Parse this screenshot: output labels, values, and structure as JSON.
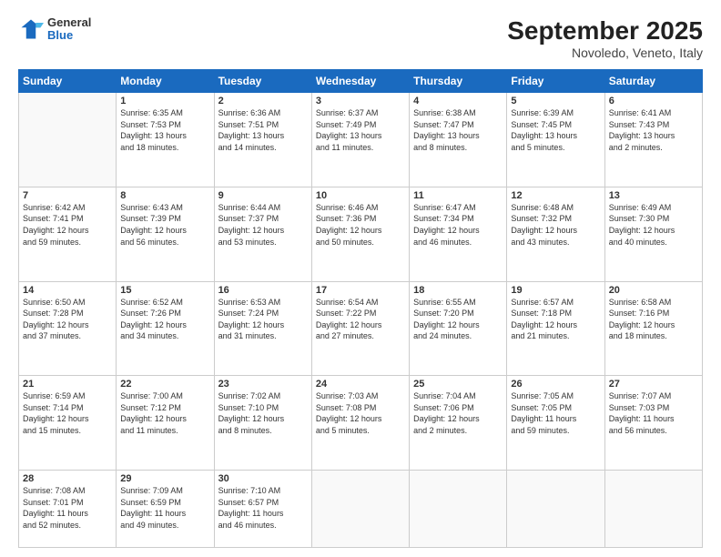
{
  "header": {
    "logo": {
      "general": "General",
      "blue": "Blue"
    },
    "title": "September 2025",
    "location": "Novoledo, Veneto, Italy"
  },
  "calendar": {
    "days_of_week": [
      "Sunday",
      "Monday",
      "Tuesday",
      "Wednesday",
      "Thursday",
      "Friday",
      "Saturday"
    ],
    "weeks": [
      [
        {
          "day": "",
          "details": ""
        },
        {
          "day": "1",
          "details": "Sunrise: 6:35 AM\nSunset: 7:53 PM\nDaylight: 13 hours\nand 18 minutes."
        },
        {
          "day": "2",
          "details": "Sunrise: 6:36 AM\nSunset: 7:51 PM\nDaylight: 13 hours\nand 14 minutes."
        },
        {
          "day": "3",
          "details": "Sunrise: 6:37 AM\nSunset: 7:49 PM\nDaylight: 13 hours\nand 11 minutes."
        },
        {
          "day": "4",
          "details": "Sunrise: 6:38 AM\nSunset: 7:47 PM\nDaylight: 13 hours\nand 8 minutes."
        },
        {
          "day": "5",
          "details": "Sunrise: 6:39 AM\nSunset: 7:45 PM\nDaylight: 13 hours\nand 5 minutes."
        },
        {
          "day": "6",
          "details": "Sunrise: 6:41 AM\nSunset: 7:43 PM\nDaylight: 13 hours\nand 2 minutes."
        }
      ],
      [
        {
          "day": "7",
          "details": "Sunrise: 6:42 AM\nSunset: 7:41 PM\nDaylight: 12 hours\nand 59 minutes."
        },
        {
          "day": "8",
          "details": "Sunrise: 6:43 AM\nSunset: 7:39 PM\nDaylight: 12 hours\nand 56 minutes."
        },
        {
          "day": "9",
          "details": "Sunrise: 6:44 AM\nSunset: 7:37 PM\nDaylight: 12 hours\nand 53 minutes."
        },
        {
          "day": "10",
          "details": "Sunrise: 6:46 AM\nSunset: 7:36 PM\nDaylight: 12 hours\nand 50 minutes."
        },
        {
          "day": "11",
          "details": "Sunrise: 6:47 AM\nSunset: 7:34 PM\nDaylight: 12 hours\nand 46 minutes."
        },
        {
          "day": "12",
          "details": "Sunrise: 6:48 AM\nSunset: 7:32 PM\nDaylight: 12 hours\nand 43 minutes."
        },
        {
          "day": "13",
          "details": "Sunrise: 6:49 AM\nSunset: 7:30 PM\nDaylight: 12 hours\nand 40 minutes."
        }
      ],
      [
        {
          "day": "14",
          "details": "Sunrise: 6:50 AM\nSunset: 7:28 PM\nDaylight: 12 hours\nand 37 minutes."
        },
        {
          "day": "15",
          "details": "Sunrise: 6:52 AM\nSunset: 7:26 PM\nDaylight: 12 hours\nand 34 minutes."
        },
        {
          "day": "16",
          "details": "Sunrise: 6:53 AM\nSunset: 7:24 PM\nDaylight: 12 hours\nand 31 minutes."
        },
        {
          "day": "17",
          "details": "Sunrise: 6:54 AM\nSunset: 7:22 PM\nDaylight: 12 hours\nand 27 minutes."
        },
        {
          "day": "18",
          "details": "Sunrise: 6:55 AM\nSunset: 7:20 PM\nDaylight: 12 hours\nand 24 minutes."
        },
        {
          "day": "19",
          "details": "Sunrise: 6:57 AM\nSunset: 7:18 PM\nDaylight: 12 hours\nand 21 minutes."
        },
        {
          "day": "20",
          "details": "Sunrise: 6:58 AM\nSunset: 7:16 PM\nDaylight: 12 hours\nand 18 minutes."
        }
      ],
      [
        {
          "day": "21",
          "details": "Sunrise: 6:59 AM\nSunset: 7:14 PM\nDaylight: 12 hours\nand 15 minutes."
        },
        {
          "day": "22",
          "details": "Sunrise: 7:00 AM\nSunset: 7:12 PM\nDaylight: 12 hours\nand 11 minutes."
        },
        {
          "day": "23",
          "details": "Sunrise: 7:02 AM\nSunset: 7:10 PM\nDaylight: 12 hours\nand 8 minutes."
        },
        {
          "day": "24",
          "details": "Sunrise: 7:03 AM\nSunset: 7:08 PM\nDaylight: 12 hours\nand 5 minutes."
        },
        {
          "day": "25",
          "details": "Sunrise: 7:04 AM\nSunset: 7:06 PM\nDaylight: 12 hours\nand 2 minutes."
        },
        {
          "day": "26",
          "details": "Sunrise: 7:05 AM\nSunset: 7:05 PM\nDaylight: 11 hours\nand 59 minutes."
        },
        {
          "day": "27",
          "details": "Sunrise: 7:07 AM\nSunset: 7:03 PM\nDaylight: 11 hours\nand 56 minutes."
        }
      ],
      [
        {
          "day": "28",
          "details": "Sunrise: 7:08 AM\nSunset: 7:01 PM\nDaylight: 11 hours\nand 52 minutes."
        },
        {
          "day": "29",
          "details": "Sunrise: 7:09 AM\nSunset: 6:59 PM\nDaylight: 11 hours\nand 49 minutes."
        },
        {
          "day": "30",
          "details": "Sunrise: 7:10 AM\nSunset: 6:57 PM\nDaylight: 11 hours\nand 46 minutes."
        },
        {
          "day": "",
          "details": ""
        },
        {
          "day": "",
          "details": ""
        },
        {
          "day": "",
          "details": ""
        },
        {
          "day": "",
          "details": ""
        }
      ]
    ]
  }
}
